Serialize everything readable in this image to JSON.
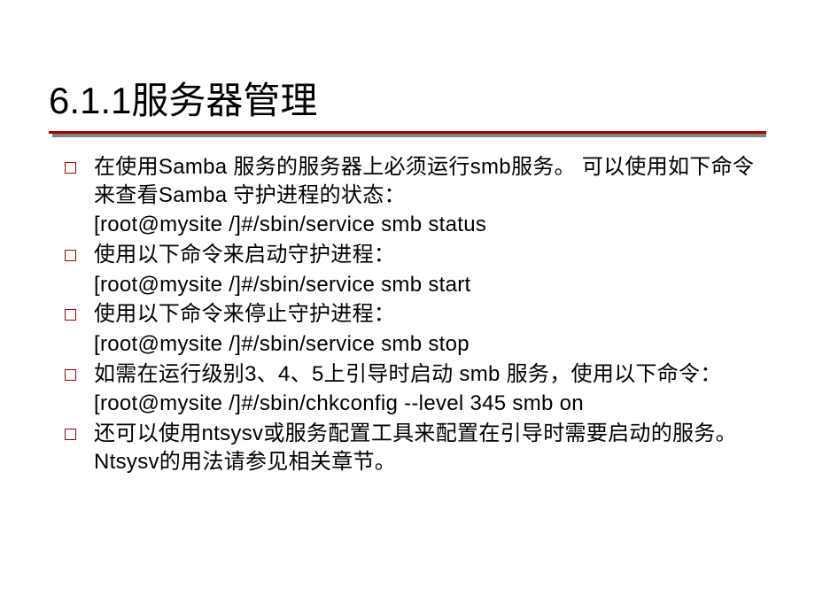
{
  "title": "6.1.1服务器管理",
  "items": [
    {
      "text": "在使用Samba 服务的服务器上必须运行smb服务。 可以使用如下命令来查看Samba 守护进程的状态：",
      "command": "[root@mysite /]#/sbin/service smb status"
    },
    {
      "text": "使用以下命令来启动守护进程：",
      "command": "[root@mysite /]#/sbin/service smb start"
    },
    {
      "text": "使用以下命令来停止守护进程：",
      "command": "[root@mysite /]#/sbin/service smb stop"
    },
    {
      "text": "如需在运行级别3、4、5上引导时启动 smb 服务，使用以下命令：",
      "command": "[root@mysite /]#/sbin/chkconfig --level 345 smb on"
    },
    {
      "text": "还可以使用ntsysv或服务配置工具来配置在引导时需要启动的服务。Ntsysv的用法请参见相关章节。",
      "command": null
    }
  ]
}
